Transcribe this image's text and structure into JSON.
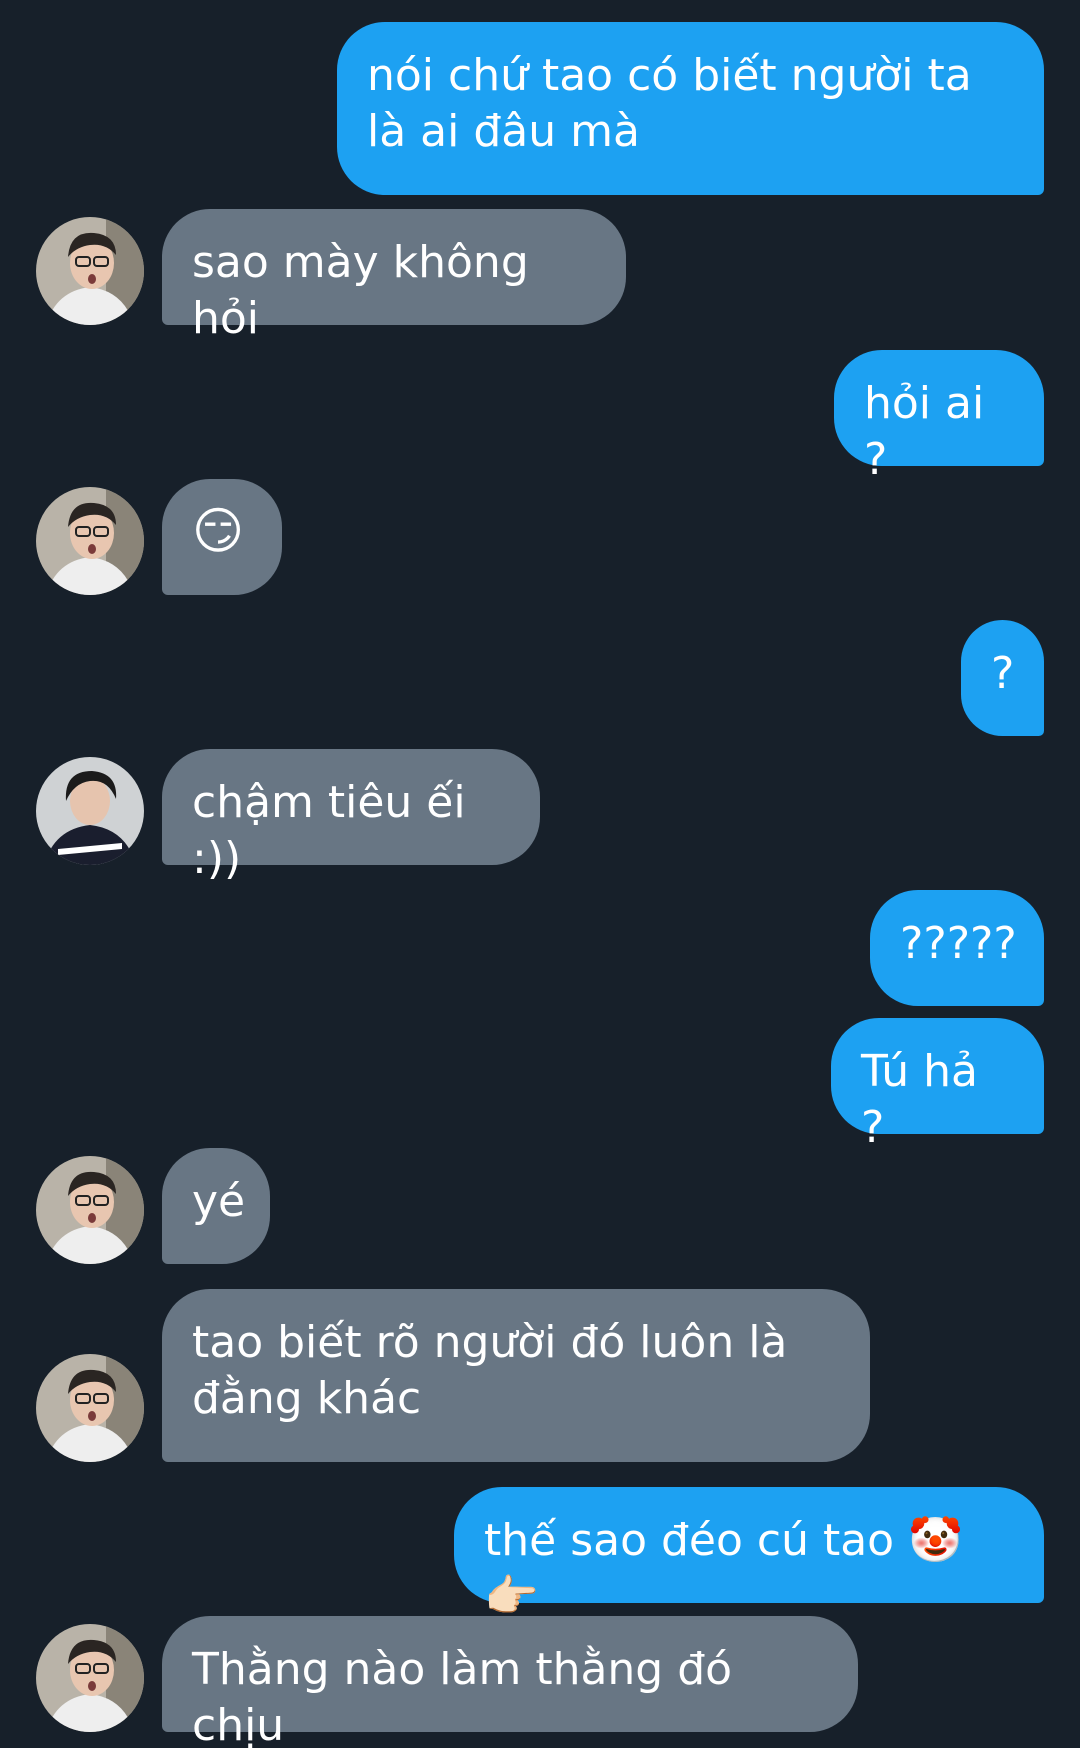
{
  "messages": [
    {
      "side": "out",
      "text": "nói chứ tao có biết người ta là ai đâu mà"
    },
    {
      "side": "in",
      "text": "sao mày không hỏi",
      "avatar": "avatar-a"
    },
    {
      "side": "out",
      "text": "hỏi ai ?"
    },
    {
      "side": "in",
      "text": "😏",
      "avatar": "avatar-a"
    },
    {
      "side": "out",
      "text": "?"
    },
    {
      "side": "in",
      "text": "chậm tiêu ếi :))",
      "avatar": "avatar-b"
    },
    {
      "side": "out",
      "text": "?????"
    },
    {
      "side": "out",
      "text": "Tú hả ?"
    },
    {
      "side": "in",
      "text": "yé",
      "avatar": "avatar-a"
    },
    {
      "side": "in",
      "text": "tao biết rõ người đó luôn là đằng khác",
      "avatar": "avatar-a"
    },
    {
      "side": "out",
      "text": "thế sao đéo cú tao 🤡👉🏻"
    },
    {
      "side": "in",
      "text": "Thằng nào làm thằng đó chịu",
      "avatar": "avatar-a"
    }
  ],
  "colors": {
    "background": "#17202a",
    "outgoing_bubble": "#1da1f2",
    "incoming_bubble": "#687684",
    "text": "#ffffff"
  }
}
